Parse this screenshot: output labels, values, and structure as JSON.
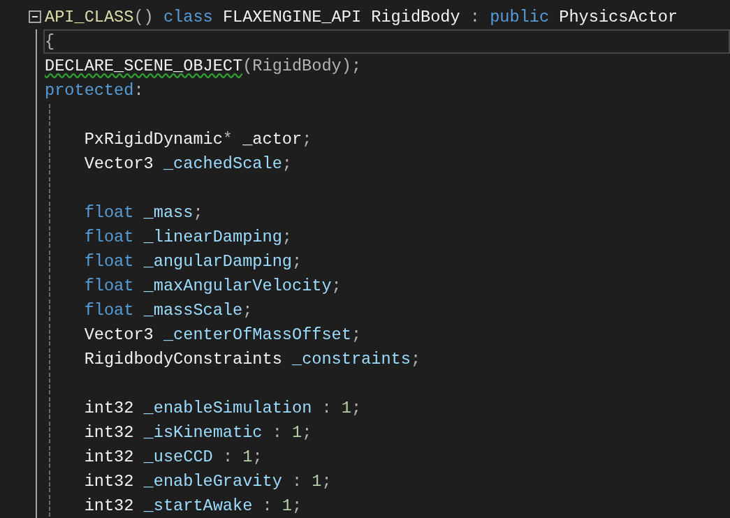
{
  "editor": {
    "lines": [
      {
        "expanded": true,
        "tokens": [
          {
            "kind": "macro",
            "text": "API_CLASS"
          },
          {
            "kind": "punct",
            "text": "() "
          },
          {
            "kind": "keyword",
            "text": "class"
          },
          {
            "kind": "plain",
            "text": " FLAXENGINE_API RigidBody "
          },
          {
            "kind": "punct",
            "text": ": "
          },
          {
            "kind": "keyword",
            "text": "public"
          },
          {
            "kind": "plain",
            "text": " PhysicsActor"
          }
        ]
      },
      {
        "current": true,
        "tokens": [
          {
            "kind": "punct",
            "text": "{"
          }
        ]
      },
      {
        "tokens": [
          {
            "kind": "plain",
            "text": "DECLARE_SCENE_OBJECT",
            "squiggle": true
          },
          {
            "kind": "punct",
            "text": "(RigidBody);"
          }
        ]
      },
      {
        "tokens": [
          {
            "kind": "keyword",
            "text": "protected"
          },
          {
            "kind": "punct",
            "text": ":"
          }
        ]
      },
      {
        "guide": true
      },
      {
        "guide": true,
        "tokens": [
          {
            "kind": "plain",
            "text": "    PxRigidDynamic"
          },
          {
            "kind": "punct",
            "text": "* "
          },
          {
            "kind": "plain",
            "text": "_actor"
          },
          {
            "kind": "punct",
            "text": ";"
          }
        ]
      },
      {
        "guide": true,
        "tokens": [
          {
            "kind": "plain",
            "text": "    Vector3 "
          },
          {
            "kind": "member",
            "text": "_cachedScale"
          },
          {
            "kind": "punct",
            "text": ";"
          }
        ]
      },
      {
        "guide": true
      },
      {
        "guide": true,
        "tokens": [
          {
            "kind": "keyword",
            "text": "    float"
          },
          {
            "kind": "member",
            "text": " _mass"
          },
          {
            "kind": "punct",
            "text": ";"
          }
        ]
      },
      {
        "guide": true,
        "tokens": [
          {
            "kind": "keyword",
            "text": "    float"
          },
          {
            "kind": "member",
            "text": " _linearDamping"
          },
          {
            "kind": "punct",
            "text": ";"
          }
        ]
      },
      {
        "guide": true,
        "tokens": [
          {
            "kind": "keyword",
            "text": "    float"
          },
          {
            "kind": "member",
            "text": " _angularDamping"
          },
          {
            "kind": "punct",
            "text": ";"
          }
        ]
      },
      {
        "guide": true,
        "tokens": [
          {
            "kind": "keyword",
            "text": "    float"
          },
          {
            "kind": "member",
            "text": " _maxAngularVelocity"
          },
          {
            "kind": "punct",
            "text": ";"
          }
        ]
      },
      {
        "guide": true,
        "tokens": [
          {
            "kind": "keyword",
            "text": "    float"
          },
          {
            "kind": "member",
            "text": " _massScale"
          },
          {
            "kind": "punct",
            "text": ";"
          }
        ]
      },
      {
        "guide": true,
        "tokens": [
          {
            "kind": "plain",
            "text": "    Vector3 "
          },
          {
            "kind": "member",
            "text": "_centerOfMassOffset"
          },
          {
            "kind": "punct",
            "text": ";"
          }
        ]
      },
      {
        "guide": true,
        "tokens": [
          {
            "kind": "plain",
            "text": "    RigidbodyConstraints "
          },
          {
            "kind": "member",
            "text": "_constraints"
          },
          {
            "kind": "punct",
            "text": ";"
          }
        ]
      },
      {
        "guide": true
      },
      {
        "guide": true,
        "tokens": [
          {
            "kind": "plain",
            "text": "    int32 "
          },
          {
            "kind": "member",
            "text": "_enableSimulation"
          },
          {
            "kind": "punct",
            "text": " : "
          },
          {
            "kind": "number",
            "text": "1"
          },
          {
            "kind": "punct",
            "text": ";"
          }
        ]
      },
      {
        "guide": true,
        "tokens": [
          {
            "kind": "plain",
            "text": "    int32 "
          },
          {
            "kind": "member",
            "text": "_isKinematic"
          },
          {
            "kind": "punct",
            "text": " : "
          },
          {
            "kind": "number",
            "text": "1"
          },
          {
            "kind": "punct",
            "text": ";"
          }
        ]
      },
      {
        "guide": true,
        "tokens": [
          {
            "kind": "plain",
            "text": "    int32 "
          },
          {
            "kind": "member",
            "text": "_useCCD"
          },
          {
            "kind": "punct",
            "text": " : "
          },
          {
            "kind": "number",
            "text": "1"
          },
          {
            "kind": "punct",
            "text": ";"
          }
        ]
      },
      {
        "guide": true,
        "tokens": [
          {
            "kind": "plain",
            "text": "    int32 "
          },
          {
            "kind": "member",
            "text": "_enableGravity"
          },
          {
            "kind": "punct",
            "text": " : "
          },
          {
            "kind": "number",
            "text": "1"
          },
          {
            "kind": "punct",
            "text": ";"
          }
        ]
      },
      {
        "guide": true,
        "tokens": [
          {
            "kind": "plain",
            "text": "    int32 "
          },
          {
            "kind": "member",
            "text": "_startAwake"
          },
          {
            "kind": "punct",
            "text": " : "
          },
          {
            "kind": "number",
            "text": "1"
          },
          {
            "kind": "punct",
            "text": ";"
          }
        ]
      }
    ]
  }
}
